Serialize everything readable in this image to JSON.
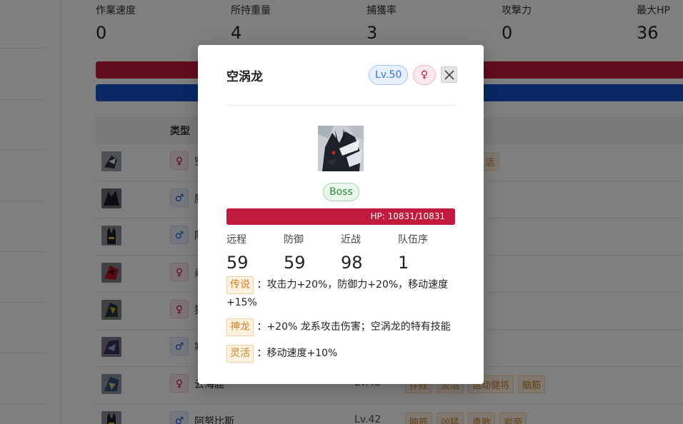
{
  "stats": [
    {
      "label": "作業速度",
      "value": "0"
    },
    {
      "label": "所持重量",
      "value": "4"
    },
    {
      "label": "捕獲率",
      "value": "3"
    },
    {
      "label": "攻撃力",
      "value": "0"
    },
    {
      "label": "最大HP",
      "value": "36"
    }
  ],
  "table": {
    "type_header": "类型",
    "rows": [
      {
        "gender": "♀",
        "gender_kind": "f",
        "name": "空",
        "level": "",
        "tags": [
          "灵活"
        ],
        "thumb": "dark-dragon"
      },
      {
        "gender": "♂",
        "gender_kind": "m",
        "name": "魔",
        "level": "",
        "tags": [],
        "thumb": "shadow"
      },
      {
        "gender": "♂",
        "gender_kind": "m",
        "name": "阿",
        "level": "",
        "tags": [],
        "thumb": "anubis"
      },
      {
        "gender": "♀",
        "gender_kind": "f",
        "name": "焱",
        "level": "",
        "tags": [],
        "thumb": "red"
      },
      {
        "gender": "♀",
        "gender_kind": "f",
        "name": "猎",
        "level": "",
        "tags": [
          ""
        ],
        "thumb": "green"
      },
      {
        "gender": "♂",
        "gender_kind": "m",
        "name": "寒",
        "level": "",
        "tags": [],
        "thumb": "purple"
      },
      {
        "gender": "♀",
        "gender_kind": "f",
        "name": "云海鹿",
        "level": "Lv.42",
        "tags": [
          "伴娃",
          "灵活",
          "运动健将",
          "脑筋"
        ],
        "thumb": "blue-dragon"
      },
      {
        "gender": "♂",
        "gender_kind": "m",
        "name": "阿努比斯",
        "level": "Lv.42",
        "tags": [
          "脑筋",
          "凶猛",
          "勇敢",
          "岩帝"
        ],
        "thumb": "anubis"
      }
    ]
  },
  "modal": {
    "title": "空涡龙",
    "level_badge": "Lv.50",
    "gender_badge": "♀",
    "boss_badge": "Boss",
    "hp_text": "HP: 10831/10831",
    "hp_fraction": 1.0,
    "stats": [
      {
        "label": "远程",
        "value": "59"
      },
      {
        "label": "防御",
        "value": "59"
      },
      {
        "label": "近战",
        "value": "98"
      },
      {
        "label": "队伍序",
        "value": "1"
      }
    ],
    "passives": [
      {
        "name": "传说",
        "desc": "：攻击力+20%，防御力+20%，移动速度+15%"
      },
      {
        "name": "神龙",
        "desc": "：+20% 龙系攻击伤害；空涡龙的特有技能"
      },
      {
        "name": "灵活",
        "desc": "：移动速度+10%"
      }
    ]
  },
  "colors": {
    "hp_red": "#c21a3c",
    "mp_blue": "#1450c8",
    "boss_green": "#2f8a3e",
    "tag_orange": "#d08328"
  },
  "icons": {
    "close": "close-icon",
    "portrait": "pal-portrait-icon"
  }
}
